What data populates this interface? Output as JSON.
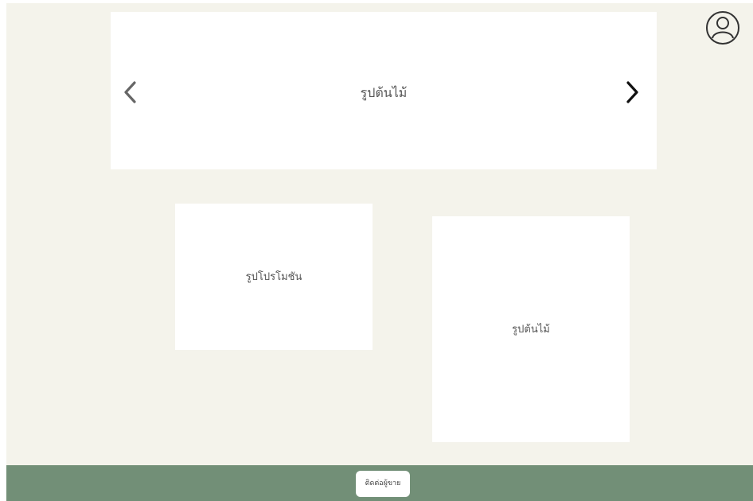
{
  "colors": {
    "page_background": "#f4f3eb",
    "panel_background": "#ffffff",
    "footer_background": "#728f77",
    "arrow_prev": "#666666",
    "arrow_next": "#111111"
  },
  "header": {
    "profile_icon": "user-circle-icon"
  },
  "hero": {
    "label": "รูปต้นไม้",
    "prev_icon": "chevron-left-icon",
    "next_icon": "chevron-right-icon"
  },
  "cards": [
    {
      "label": "รูปโปรโมชัน"
    },
    {
      "label": "รูปต้นไม้"
    }
  ],
  "footer": {
    "contact_label": "ติดต่อผู้ขาย"
  }
}
